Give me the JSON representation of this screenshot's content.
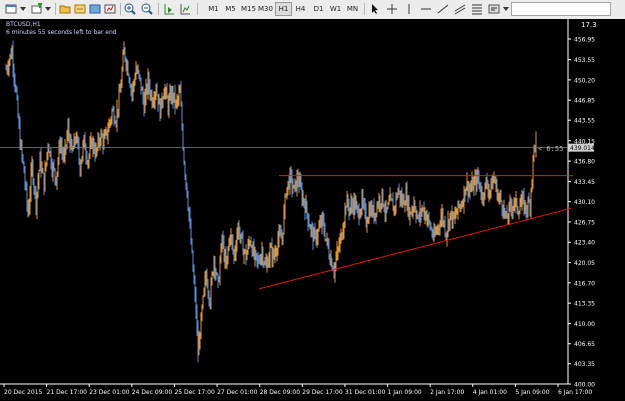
{
  "window": {
    "symbol_timeframe": "BTCUSD,H1",
    "countdown_text": "6 minutes 55 seconds left to bar end",
    "top_right_value": "17.3"
  },
  "toolbar": {
    "timeframes": [
      "M1",
      "M5",
      "M15",
      "M30",
      "H1",
      "H4",
      "D1",
      "W1",
      "MN"
    ],
    "active_timeframe": "H1"
  },
  "price_label": {
    "current_price": "439.014",
    "countdown_marker": "< 6:55"
  },
  "colors": {
    "bull_candle": "#e8962e",
    "bear_candle": "#5b8fd6",
    "trendline": "#e81414",
    "current_price_line": "#808080",
    "axis_text": "#ffffff"
  },
  "chart_data": {
    "type": "candlestick",
    "title": "BTCUSD,H1",
    "y_tick_labels": [
      "456.95",
      "453.55",
      "450.20",
      "446.85",
      "443.55",
      "440.15",
      "436.80",
      "433.45",
      "430.10",
      "426.75",
      "423.40",
      "420.05",
      "416.70",
      "413.35",
      "410.00",
      "406.65",
      "403.35",
      "400.00"
    ],
    "x_tick_labels": [
      "20 Dec 2015",
      "21 Dec 17:00",
      "23 Dec 01:00",
      "24 Dec 09:00",
      "25 Dec 17:00",
      "27 Dec 01:00",
      "28 Dec 09:00",
      "29 Dec 17:00",
      "31 Dec 01:00",
      "1 Jan 09:00",
      "2 Jan 17:00",
      "4 Jan 01:00",
      "5 Jan 09:00",
      "6 Jan 17:00"
    ],
    "ylim": [
      400.0,
      456.95
    ],
    "horizontal_line_price": 434.4,
    "support_trendline": {
      "from_price": 415.7,
      "to_price": 429.0
    },
    "current_price": 439.014,
    "approx_close_path": [
      [
        0,
        452
      ],
      [
        6,
        455
      ],
      [
        10,
        448
      ],
      [
        14,
        440
      ],
      [
        18,
        435
      ],
      [
        22,
        428
      ],
      [
        26,
        436
      ],
      [
        30,
        430
      ],
      [
        34,
        437
      ],
      [
        38,
        433
      ],
      [
        42,
        440
      ],
      [
        46,
        436
      ],
      [
        50,
        434
      ],
      [
        54,
        440
      ],
      [
        58,
        437
      ],
      [
        62,
        442
      ],
      [
        66,
        438
      ],
      [
        70,
        441
      ],
      [
        74,
        436
      ],
      [
        78,
        440
      ],
      [
        82,
        437
      ],
      [
        86,
        440
      ],
      [
        90,
        438
      ],
      [
        94,
        441
      ],
      [
        98,
        440
      ],
      [
        102,
        442
      ],
      [
        106,
        445
      ],
      [
        110,
        444
      ],
      [
        114,
        448
      ],
      [
        118,
        455
      ],
      [
        122,
        452
      ],
      [
        126,
        448
      ],
      [
        130,
        452
      ],
      [
        134,
        450
      ],
      [
        138,
        446
      ],
      [
        142,
        450
      ],
      [
        146,
        447
      ],
      [
        150,
        449
      ],
      [
        154,
        445
      ],
      [
        158,
        449
      ],
      [
        162,
        446
      ],
      [
        166,
        448
      ],
      [
        170,
        446
      ],
      [
        174,
        448
      ],
      [
        178,
        437
      ],
      [
        182,
        430
      ],
      [
        186,
        421
      ],
      [
        190,
        412
      ],
      [
        192,
        405
      ],
      [
        196,
        412
      ],
      [
        200,
        418
      ],
      [
        204,
        414
      ],
      [
        208,
        421
      ],
      [
        212,
        416
      ],
      [
        216,
        424
      ],
      [
        220,
        419
      ],
      [
        224,
        425
      ],
      [
        228,
        421
      ],
      [
        232,
        426
      ],
      [
        236,
        423
      ],
      [
        240,
        421
      ],
      [
        244,
        424
      ],
      [
        248,
        421
      ],
      [
        252,
        420
      ],
      [
        256,
        422
      ],
      [
        260,
        419
      ],
      [
        264,
        422
      ],
      [
        268,
        421
      ],
      [
        272,
        424
      ],
      [
        276,
        424
      ],
      [
        280,
        432
      ],
      [
        284,
        434
      ],
      [
        288,
        432
      ],
      [
        292,
        434
      ],
      [
        296,
        431
      ],
      [
        300,
        429
      ],
      [
        304,
        426
      ],
      [
        308,
        424
      ],
      [
        312,
        425
      ],
      [
        316,
        427
      ],
      [
        320,
        424
      ],
      [
        324,
        421
      ],
      [
        328,
        419
      ],
      [
        332,
        422
      ],
      [
        336,
        425
      ],
      [
        340,
        430
      ],
      [
        344,
        429
      ],
      [
        348,
        430
      ],
      [
        352,
        428
      ],
      [
        356,
        430
      ],
      [
        360,
        427
      ],
      [
        364,
        429
      ],
      [
        368,
        428
      ],
      [
        372,
        430
      ],
      [
        376,
        431
      ],
      [
        380,
        428
      ],
      [
        384,
        430
      ],
      [
        388,
        429
      ],
      [
        392,
        432
      ],
      [
        396,
        430
      ],
      [
        400,
        431
      ],
      [
        404,
        428
      ],
      [
        408,
        430
      ],
      [
        412,
        427
      ],
      [
        416,
        429
      ],
      [
        420,
        428
      ],
      [
        424,
        426
      ],
      [
        428,
        424
      ],
      [
        432,
        426
      ],
      [
        436,
        428
      ],
      [
        440,
        425
      ],
      [
        444,
        428
      ],
      [
        448,
        427
      ],
      [
        452,
        429
      ],
      [
        456,
        430
      ],
      [
        460,
        433
      ],
      [
        464,
        432
      ],
      [
        468,
        433
      ],
      [
        472,
        434
      ],
      [
        476,
        431
      ],
      [
        480,
        433
      ],
      [
        484,
        432
      ],
      [
        488,
        434
      ],
      [
        492,
        431
      ],
      [
        496,
        430
      ],
      [
        500,
        427
      ],
      [
        504,
        429
      ],
      [
        508,
        430
      ],
      [
        512,
        429
      ],
      [
        516,
        430
      ],
      [
        520,
        429
      ],
      [
        524,
        430
      ],
      [
        528,
        439
      ],
      [
        530,
        440
      ]
    ]
  }
}
